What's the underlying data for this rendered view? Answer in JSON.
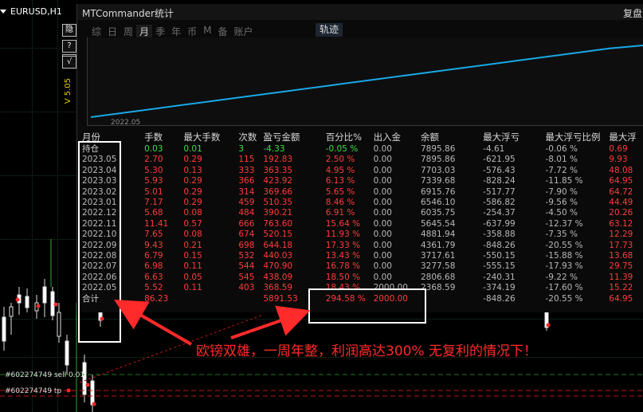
{
  "chart": {
    "symbol": "EURUSD,H1",
    "version_label": "V 5.05",
    "side_buttons": [
      "隐",
      "?",
      "?",
      "√"
    ],
    "order_lines": [
      "#602274749 sell 0.01",
      "#602274749 tp"
    ]
  },
  "panel": {
    "title": "MTCommander统计",
    "title_right": "复盘",
    "tabs": [
      "综",
      "日",
      "周",
      "月",
      "季",
      "年",
      "币",
      "M",
      "备",
      "账户"
    ],
    "active_tab": "月",
    "track_tab": "轨迹",
    "curve_axis_label": "2022.05",
    "curve_points": [
      0,
      6,
      12,
      18,
      24,
      30,
      36,
      42,
      48,
      54,
      60,
      66,
      72,
      78,
      84,
      90,
      96,
      100
    ],
    "columns": [
      "月份",
      "手数",
      "最大手数",
      "次数",
      "盈亏金额",
      "百分比%",
      "出入金",
      "余额",
      "最大浮亏",
      "最大浮亏比例",
      "最大浮"
    ],
    "rows": [
      [
        "持仓",
        "0.03",
        "0.01",
        "3",
        "-4.33",
        "-0.05 %",
        "0.00",
        "7895.86",
        "-4.61",
        "-0.06 %",
        "0.69"
      ],
      [
        "2023.05",
        "2.70",
        "0.29",
        "115",
        "192.83",
        "2.50 %",
        "0.00",
        "7895.86",
        "-621.95",
        "-8.01 %",
        "9.93"
      ],
      [
        "2023.04",
        "5.30",
        "0.13",
        "333",
        "363.35",
        "4.95 %",
        "0.00",
        "7703.03",
        "-576.43",
        "-7.72 %",
        "48.08"
      ],
      [
        "2023.03",
        "5.93",
        "0.29",
        "366",
        "423.92",
        "6.13 %",
        "0.00",
        "7339.68",
        "-828.24",
        "-11.85 %",
        "64.95"
      ],
      [
        "2023.02",
        "5.01",
        "0.29",
        "314",
        "369.66",
        "5.65 %",
        "0.00",
        "6915.76",
        "-517.77",
        "-7.90 %",
        "64.72"
      ],
      [
        "2023.01",
        "7.17",
        "0.29",
        "459",
        "510.35",
        "8.46 %",
        "0.00",
        "6546.10",
        "-586.82",
        "-9.56 %",
        "44.49"
      ],
      [
        "2022.12",
        "5.68",
        "0.08",
        "484",
        "390.21",
        "6.91 %",
        "0.00",
        "6035.75",
        "-254.37",
        "-4.50 %",
        "20.26"
      ],
      [
        "2022.11",
        "11.41",
        "0.57",
        "666",
        "763.60",
        "15.64 %",
        "0.00",
        "5645.54",
        "-637.99",
        "-12.37 %",
        "63.12"
      ],
      [
        "2022.10",
        "7.65",
        "0.08",
        "674",
        "520.15",
        "11.93 %",
        "0.00",
        "4881.94",
        "-358.88",
        "-7.35 %",
        "12.29"
      ],
      [
        "2022.09",
        "9.43",
        "0.21",
        "698",
        "644.18",
        "17.33 %",
        "0.00",
        "4361.79",
        "-848.26",
        "-20.55 %",
        "17.73"
      ],
      [
        "2022.08",
        "6.79",
        "0.15",
        "532",
        "440.03",
        "13.43 %",
        "0.00",
        "3717.61",
        "-550.15",
        "-15.88 %",
        "13.68"
      ],
      [
        "2022.07",
        "6.98",
        "0.11",
        "544",
        "470.90",
        "16.78 %",
        "0.00",
        "3277.58",
        "-555.15",
        "-17.93 %",
        "29.75"
      ],
      [
        "2022.06",
        "6.63",
        "0.05",
        "545",
        "438.09",
        "18.50 %",
        "0.00",
        "2806.68",
        "-240.31",
        "-9.22 %",
        "11.39"
      ],
      [
        "2022.05",
        "5.52",
        "0.11",
        "403",
        "368.59",
        "18.43 %",
        "2000.00",
        "2368.59",
        "-374.19",
        "-17.60 %",
        "15.22"
      ],
      [
        "合计",
        "86.23",
        "",
        "",
        "5891.53",
        "294.58 %",
        "2000.00",
        "",
        "-848.26",
        "-20.55 %",
        "64.95"
      ]
    ]
  },
  "annotation": {
    "caption": "欧镑双雄，一周年整，利润高达300%  无复利的情况下！"
  },
  "colors": {
    "profit": "#ff3b3b",
    "open_position": "#38e040",
    "curve": "#19a8e6",
    "annotation": "#ff2a2a"
  }
}
